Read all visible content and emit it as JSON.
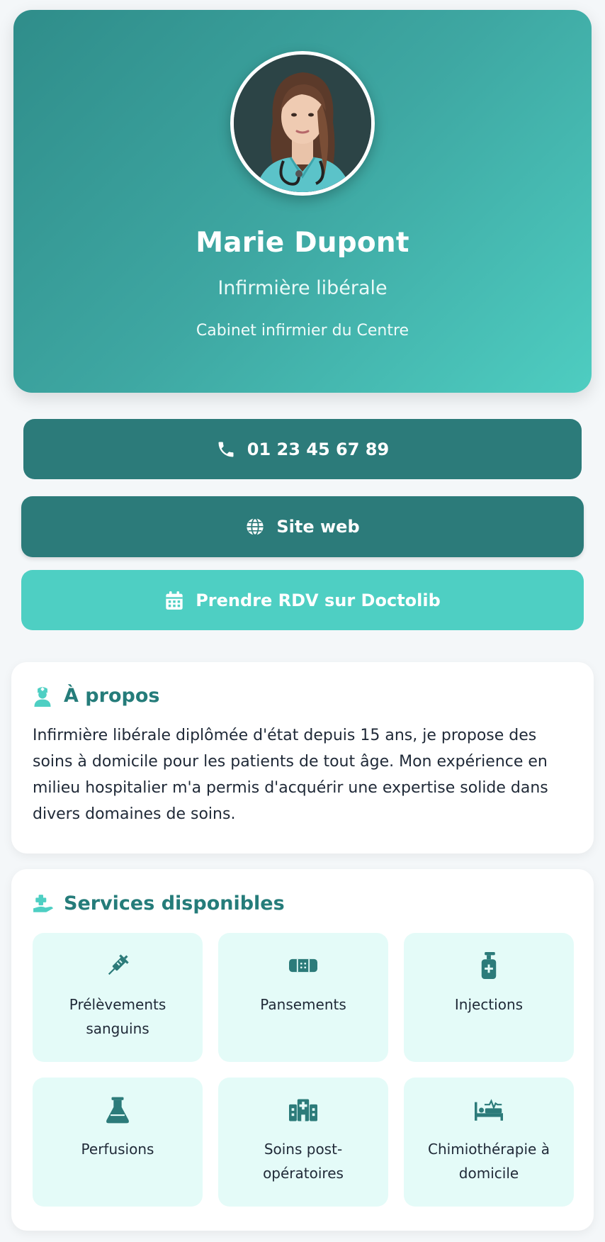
{
  "profile": {
    "name": "Marie Dupont",
    "role": "Infirmière libérale",
    "office": "Cabinet infirmier du Centre",
    "avatar_icon": "nurse-portrait"
  },
  "actions": {
    "phone_label": "01 23 45 67 89",
    "web_label": "Site web",
    "rdv_label": "Prendre RDV sur Doctolib"
  },
  "about": {
    "title": "À propos",
    "text": "Infirmière libérale diplômée d'état depuis 15 ans, je propose des soins à domicile pour les patients de tout âge. Mon expérience en milieu hospitalier m'a permis d'acquérir une expertise solide dans divers domaines de soins."
  },
  "services": {
    "title": "Services disponibles",
    "items": [
      {
        "label": "Prélèvements sanguins",
        "icon": "syringe-icon"
      },
      {
        "label": "Pansements",
        "icon": "bandage-icon"
      },
      {
        "label": "Injections",
        "icon": "pump-bottle-icon"
      },
      {
        "label": "Perfusions",
        "icon": "flask-icon"
      },
      {
        "label": "Soins post-opératoires",
        "icon": "hospital-icon"
      },
      {
        "label": "Chimiothérapie à domicile",
        "icon": "bed-pulse-icon"
      }
    ]
  },
  "colors": {
    "primary": "#2c7b7a",
    "accent": "#4ecfc3",
    "title": "#257c7a",
    "service_bg": "#e4fbf8"
  }
}
